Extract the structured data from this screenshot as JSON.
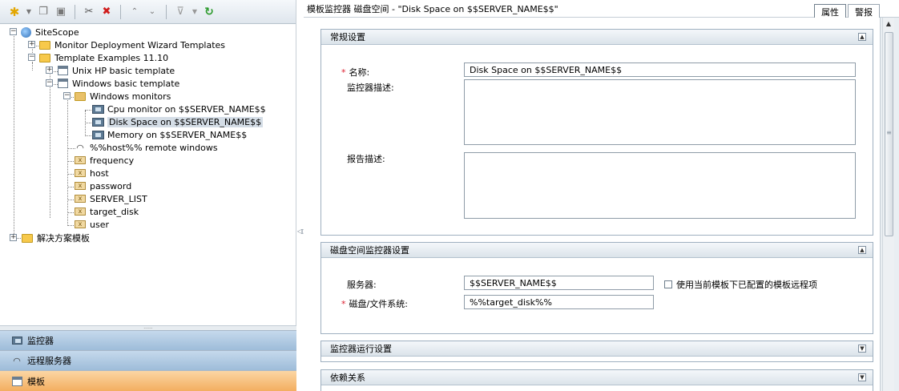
{
  "toolbar": {
    "icons": [
      "new-star-icon",
      "dropdown-arrow-icon",
      "copy-icon",
      "save-icon",
      "cut-icon",
      "delete-icon",
      "expand-all-icon",
      "collapse-all-icon",
      "filter-icon",
      "filter-dropdown-icon",
      "refresh-icon"
    ]
  },
  "tree": {
    "root": "SiteScope",
    "items": [
      "Monitor Deployment Wizard Templates",
      "Template Examples 11.10",
      "Unix HP basic template",
      "Windows basic template",
      "Windows monitors",
      "Cpu monitor on $$SERVER_NAME$$",
      "Disk Space on $$SERVER_NAME$$",
      "Memory on $$SERVER_NAME$$",
      "%%host%% remote windows",
      "frequency",
      "host",
      "password",
      "SERVER_LIST",
      "target_disk",
      "user",
      "解决方案模板"
    ]
  },
  "splitter": "......",
  "nav": {
    "monitors": "监控器",
    "remote_servers": "远程服务器",
    "templates": "模板"
  },
  "header": {
    "title": "模板监控器 磁盘空间 - \"Disk Space on $$SERVER_NAME$$\"",
    "tab_properties": "属性",
    "tab_alerts": "警报"
  },
  "general": {
    "title": "常规设置",
    "name_label": "名称:",
    "name_value": "Disk Space on $$SERVER_NAME$$",
    "monitor_desc_label": "监控器描述:",
    "report_desc_label": "报告描述:"
  },
  "disk": {
    "title": "磁盘空间监控器设置",
    "server_label": "服务器:",
    "server_value": "$$SERVER_NAME$$",
    "checkbox_label": "使用当前模板下已配置的模板远程项",
    "fs_label": "磁盘/文件系统:",
    "fs_value": "%%target_disk%%"
  },
  "run": {
    "title": "监控器运行设置"
  },
  "deps": {
    "title": "依赖关系"
  },
  "symbols": {
    "required": "*",
    "plus": "+",
    "minus": "−",
    "collapse_up": "▲",
    "collapse_down": "▼",
    "grip": "≡",
    "divider": "◁▷"
  },
  "colors": {
    "nav_blue": "#9ebcd9",
    "nav_orange": "#f3ae60",
    "required": "#d22233"
  }
}
